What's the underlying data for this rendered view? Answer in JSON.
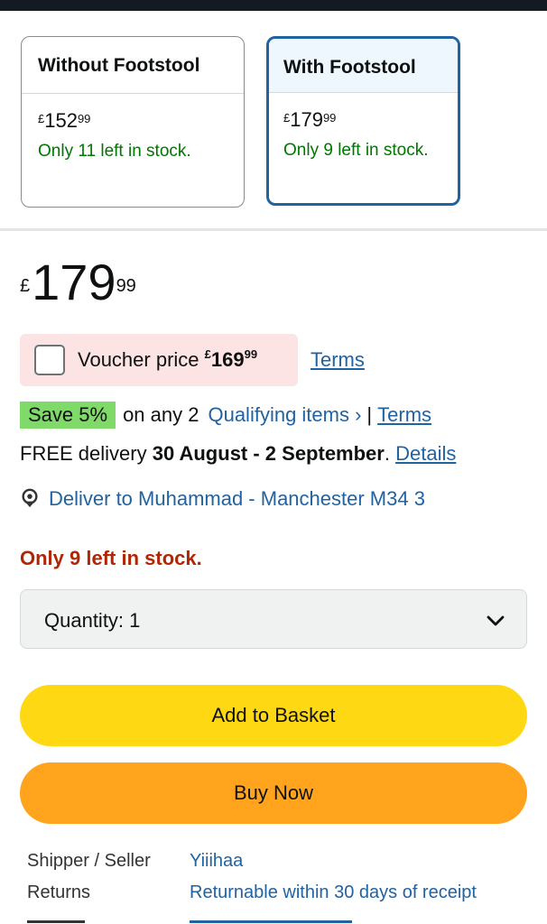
{
  "variants": [
    {
      "name": "Without Footstool",
      "price_currency": "£",
      "price_whole": "152",
      "price_fraction": "99",
      "stock": "Only 11 left in stock.",
      "selected": false
    },
    {
      "name": "With Footstool",
      "price_currency": "£",
      "price_whole": "179",
      "price_fraction": "99",
      "stock": "Only 9 left in stock.",
      "selected": true
    }
  ],
  "price": {
    "currency": "£",
    "whole": "179",
    "fraction": "99"
  },
  "voucher": {
    "label": "Voucher price",
    "currency": "£",
    "whole": "169",
    "fraction": "99",
    "terms": "Terms",
    "checked": false
  },
  "promo": {
    "badge": "Save 5%",
    "text": "on any 2",
    "link": "Qualifying items ›",
    "separator": "|",
    "terms": "Terms"
  },
  "delivery": {
    "prefix": "FREE delivery",
    "dates": "30 August - 2 September",
    "suffix": ".",
    "details": "Details"
  },
  "deliver_to": {
    "text": "Deliver to Muhammad - Manchester M34 3",
    "icon": "location-pin-icon"
  },
  "stock_status": "Only 9 left in stock.",
  "quantity": {
    "label": "Quantity:",
    "value": "1"
  },
  "buttons": {
    "add_to_basket": "Add to Basket",
    "buy_now": "Buy Now"
  },
  "info": [
    {
      "key": "Shipper / Seller",
      "value": "Yiiihaa"
    },
    {
      "key": "Returns",
      "value": "Returnable within 30 days of receipt"
    }
  ],
  "colors": {
    "link": "#2162a1",
    "in_stock": "#007600",
    "low_stock": "#b12704",
    "add_button": "#ffd814",
    "buy_button": "#ffa41c",
    "voucher_bg": "#fde4e4",
    "save_badge": "#7fda69"
  }
}
